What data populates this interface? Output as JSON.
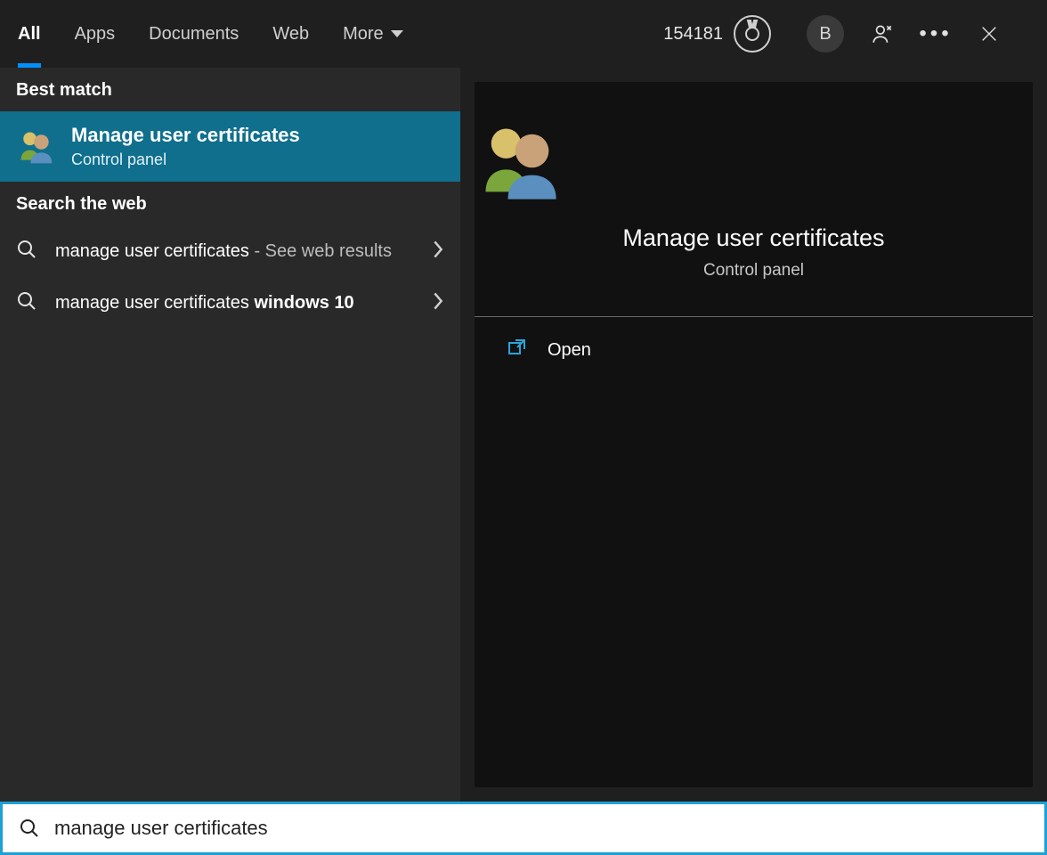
{
  "tabs": {
    "all": "All",
    "apps": "Apps",
    "documents": "Documents",
    "web": "Web",
    "more": "More"
  },
  "rewards": {
    "points": "154181"
  },
  "profile": {
    "initial": "B"
  },
  "left": {
    "best_match_header": "Best match",
    "best_match": {
      "title": "Manage user certificates",
      "subtitle": "Control panel"
    },
    "web_header": "Search the web",
    "web_results": [
      {
        "query": "manage user certificates",
        "suffix": " - See web results",
        "bold": ""
      },
      {
        "query": "manage user certificates ",
        "suffix": "",
        "bold": "windows 10"
      }
    ]
  },
  "detail": {
    "title": "Manage user certificates",
    "subtitle": "Control panel",
    "actions": {
      "open": "Open"
    }
  },
  "searchbar": {
    "value": "manage user certificates"
  }
}
